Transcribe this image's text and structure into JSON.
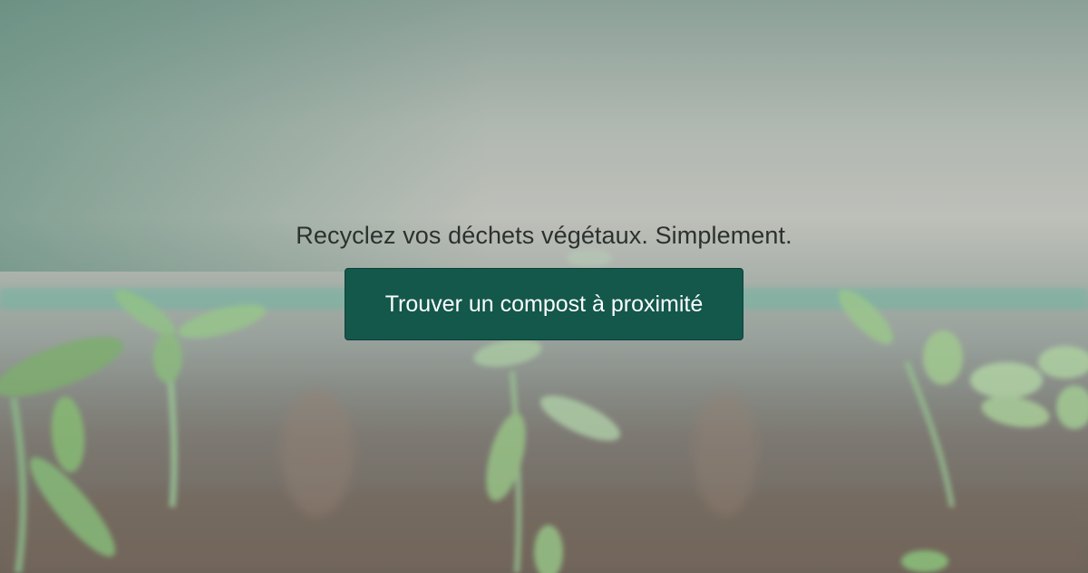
{
  "hero": {
    "tagline": "Recyclez vos déchets végétaux. Simplement.",
    "cta_label": "Trouver un compost à proximité",
    "button_color": "#13584b",
    "text_color": "#2c312e"
  }
}
